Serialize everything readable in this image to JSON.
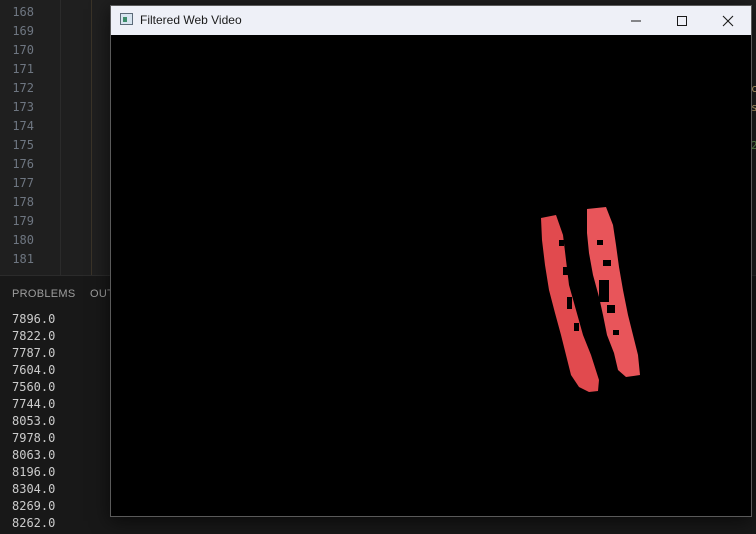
{
  "editor": {
    "line_numbers": [
      "168",
      "169",
      "170",
      "171",
      "172",
      "173",
      "174",
      "175",
      "176",
      "177",
      "178",
      "179",
      "180",
      "181"
    ],
    "fragments": [
      {
        "text": "c",
        "color": "#d7ba7d"
      },
      {
        "text": "s",
        "color": "#d7ba7d"
      },
      {
        "text": "2",
        "color": "#6a9955"
      }
    ]
  },
  "panel": {
    "tabs": [
      "PROBLEMS",
      "OUT"
    ],
    "output_lines": [
      "7896.0",
      "7822.0",
      "7787.0",
      "7604.0",
      "7560.0",
      "7744.0",
      "8053.0",
      "7978.0",
      "8063.0",
      "8196.0",
      "8304.0",
      "8269.0",
      "8262.0"
    ]
  },
  "window": {
    "title": "Filtered Web Video",
    "controls": [
      "minimize-icon",
      "maximize-icon",
      "close-icon"
    ],
    "video_background": "#000000",
    "blob_color": "#e5484d"
  }
}
